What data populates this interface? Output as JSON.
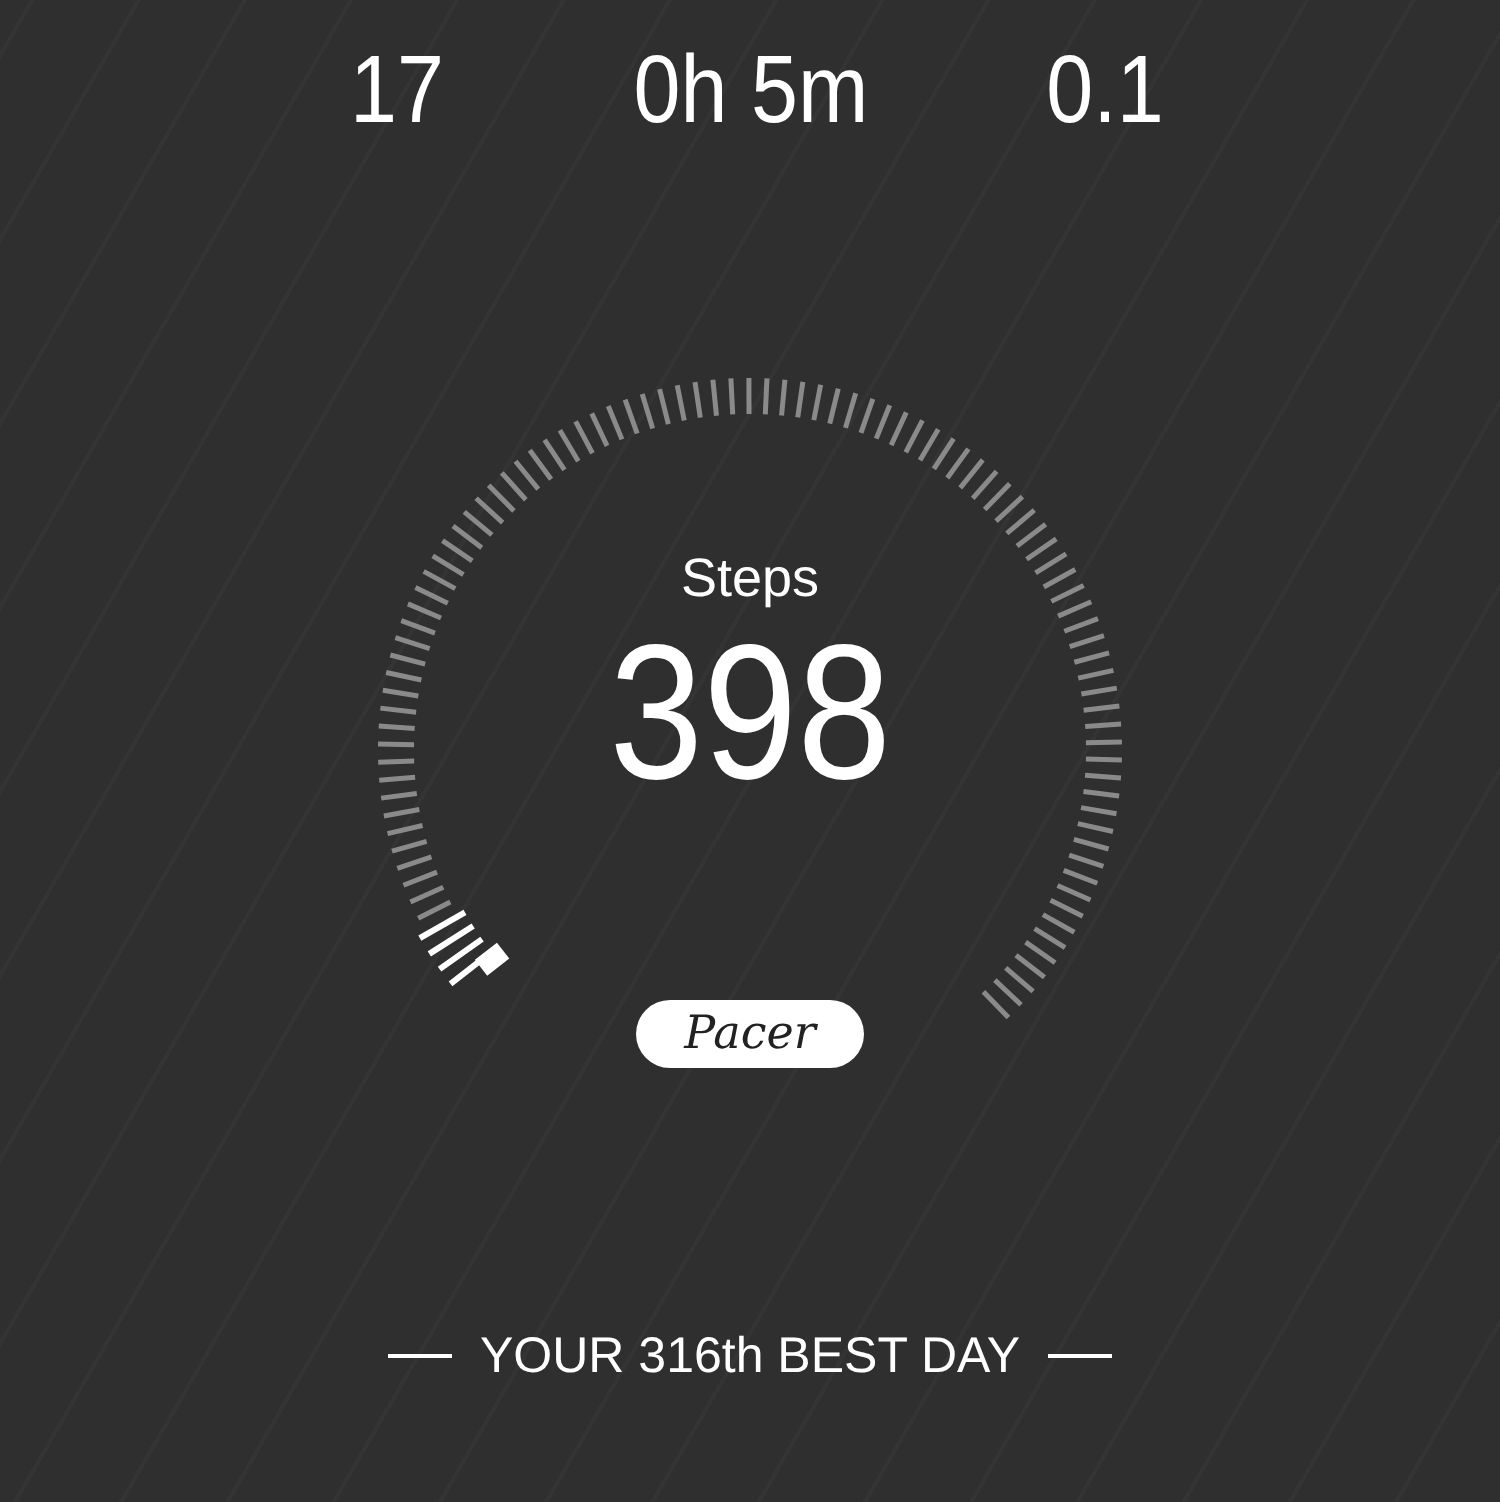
{
  "stats": [
    {
      "value": "17"
    },
    {
      "value": "0h 5m"
    },
    {
      "value": "0.1"
    }
  ],
  "gauge": {
    "label": "Steps",
    "value": "398"
  },
  "badge": "Pacer",
  "footer": "YOUR 316th BEST DAY"
}
